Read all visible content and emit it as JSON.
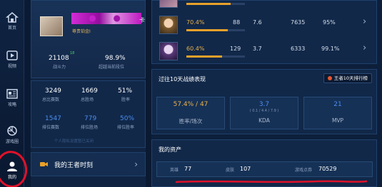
{
  "nav": {
    "items": [
      {
        "label": "首页",
        "icon": "home-icon"
      },
      {
        "label": "视频",
        "icon": "play-icon"
      },
      {
        "label": "攻略",
        "icon": "news-icon"
      },
      {
        "label": "游戏圈",
        "icon": "aperture-icon"
      },
      {
        "label": "我的",
        "icon": "user-icon"
      }
    ]
  },
  "profile": {
    "name_suffix": "卡",
    "rank_label": "尊贵铂金I",
    "power_value": "21108",
    "power_delta": "18",
    "power_label": "战斗力",
    "winrate_value": "98.9%",
    "winrate_label": "超越当前段位",
    "stats": [
      {
        "value": "3249",
        "label": "总比赛数"
      },
      {
        "value": "1669",
        "label": "总胜场"
      },
      {
        "value": "51%",
        "label": "胜率"
      },
      {
        "value": "1547",
        "label": "排位赛数"
      },
      {
        "value": "779",
        "label": "排位胜场"
      },
      {
        "value": "50%",
        "label": "排位胜率"
      }
    ],
    "note": "个人隐私设置暂已关闭",
    "moment_label": "我的王者时刻"
  },
  "heroes": [
    {
      "winrate": "",
      "winrate_pct": 75,
      "games": "",
      "kda": "",
      "power": "",
      "beat": ""
    },
    {
      "winrate": "70.4%",
      "winrate_pct": 70.4,
      "games": "88",
      "kda": "7.6",
      "power": "7635",
      "beat": "95%"
    },
    {
      "winrate": "60.4%",
      "winrate_pct": 60.4,
      "games": "129",
      "kda": "3.7",
      "power": "6333",
      "beat": "99.1%"
    }
  ],
  "history": {
    "title": "过往10天战绩表现",
    "button_label": "王者10天排行榜",
    "cards": [
      {
        "value": "57.4% / 47",
        "sub": "",
        "label": "胜率/场次",
        "color": "#e8b24b"
      },
      {
        "value": "3.7",
        "sub": "( 0.1 / 4.4 / 7.9 )",
        "label": "KDA",
        "color": "#4b8df0"
      },
      {
        "value": "21",
        "sub": "",
        "label": "MVP",
        "color": "#4b8df0"
      }
    ]
  },
  "assets": {
    "title": "我的资产",
    "items": [
      {
        "label": "英雄",
        "value": "77"
      },
      {
        "label": "皮肤",
        "value": "107"
      },
      {
        "label": "游戏点券",
        "value": "70529"
      }
    ]
  },
  "colors": {
    "accent": "#e8a12a",
    "blue": "#4b8df0",
    "annotation_red": "#e0112a"
  }
}
